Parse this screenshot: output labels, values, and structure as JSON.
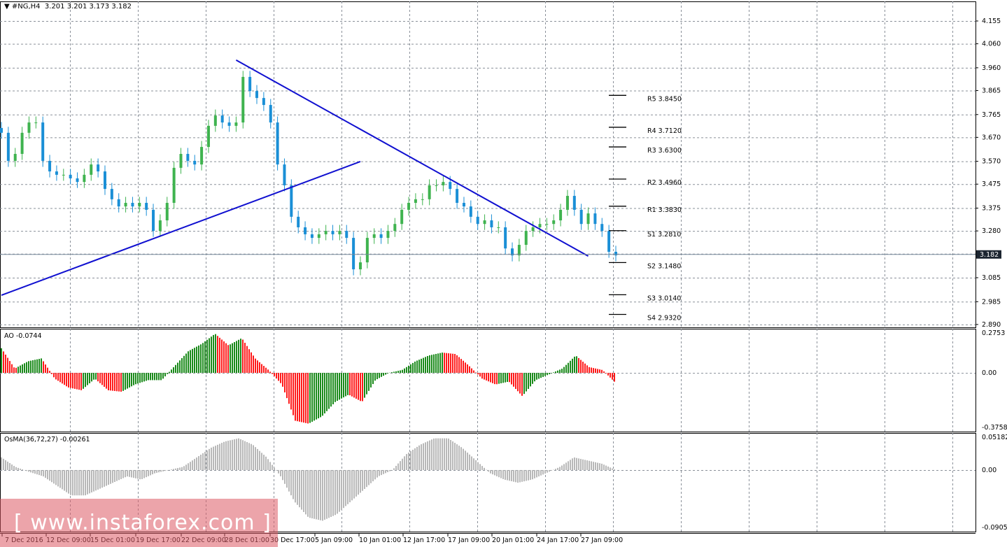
{
  "header": {
    "symbol": "#NG,H4",
    "ohlc": "3.201 3.201 3.173 3.182"
  },
  "colors": {
    "up": "#3fb34f",
    "down": "#1a8fd6",
    "trend": "#1010d0",
    "ao_up": "#1a8a1a",
    "ao_down": "#ff1a1a",
    "osma": "#b8b8b8",
    "grid": "#8a9099"
  },
  "chart_data": [
    {
      "type": "candlestick",
      "name": "price",
      "ylim": [
        2.86,
        4.2
      ],
      "y_ticks": [
        "4.155",
        "4.060",
        "3.960",
        "3.865",
        "3.765",
        "3.670",
        "3.570",
        "3.475",
        "3.375",
        "3.280",
        "3.185",
        "3.085",
        "2.985",
        "2.890"
      ],
      "closes": [
        3.689,
        3.572,
        3.601,
        3.689,
        3.732,
        3.732,
        3.572,
        3.528,
        3.514,
        3.514,
        3.499,
        3.484,
        3.514,
        3.557,
        3.528,
        3.455,
        3.412,
        3.382,
        3.397,
        3.382,
        3.397,
        3.368,
        3.28,
        3.324,
        3.397,
        3.543,
        3.601,
        3.572,
        3.557,
        3.63,
        3.718,
        3.761,
        3.732,
        3.718,
        3.732,
        3.922,
        3.863,
        3.834,
        3.805,
        3.732,
        3.557,
        3.47,
        3.339,
        3.295,
        3.266,
        3.251,
        3.266,
        3.28,
        3.266,
        3.28,
        3.251,
        3.12,
        3.149,
        3.251,
        3.266,
        3.251,
        3.28,
        3.309,
        3.368,
        3.397,
        3.412,
        3.412,
        3.47,
        3.47,
        3.484,
        3.455,
        3.397,
        3.382,
        3.339,
        3.309,
        3.324,
        3.295,
        3.295,
        3.207,
        3.178,
        3.222,
        3.28,
        3.295,
        3.309,
        3.309,
        3.324,
        3.368,
        3.426,
        3.368,
        3.309,
        3.353,
        3.309,
        3.28,
        3.193,
        3.178
      ],
      "current_price": "3.182",
      "trendlines": [
        {
          "from": [
            0,
            3.012
          ],
          "to": [
            52,
            3.569
          ]
        },
        {
          "from": [
            34,
            3.992
          ],
          "to": [
            85,
            3.175
          ]
        }
      ],
      "pivots": [
        {
          "label": "R5 3.8450",
          "value": 3.845
        },
        {
          "label": "R4 3.7120",
          "value": 3.712
        },
        {
          "label": "R3 3.6300",
          "value": 3.63
        },
        {
          "label": "R2 3.4960",
          "value": 3.496
        },
        {
          "label": "R1 3.3830",
          "value": 3.383
        },
        {
          "label": "S1 3.2810",
          "value": 3.281
        },
        {
          "label": "S2 3.1480",
          "value": 3.148
        },
        {
          "label": "S3 3.0140",
          "value": 3.014
        },
        {
          "label": "S4 2.9320",
          "value": 2.932
        }
      ]
    },
    {
      "type": "bar",
      "name": "AO",
      "title": "AO -0.0744",
      "ylim": [
        -0.3758,
        0.2753
      ],
      "y_ticks": [
        "0.2753",
        "0.00",
        "-0.3758"
      ],
      "values": [
        0.17,
        0.03,
        0.08,
        0.1,
        -0.04,
        -0.1,
        -0.12,
        -0.04,
        -0.12,
        -0.13,
        -0.08,
        -0.05,
        -0.05,
        0.05,
        0.15,
        0.2,
        0.27,
        0.19,
        0.24,
        0.1,
        0.02,
        -0.08,
        -0.33,
        -0.35,
        -0.3,
        -0.2,
        -0.15,
        -0.2,
        -0.05,
        0.0,
        0.02,
        0.08,
        0.12,
        0.14,
        0.13,
        0.05,
        -0.04,
        -0.08,
        -0.06,
        -0.16,
        -0.05,
        -0.01,
        0.03,
        0.12,
        0.04,
        0.02,
        -0.07
      ]
    },
    {
      "type": "bar",
      "name": "OsMA",
      "title": "OsMA(36,72,27) -0.00261",
      "ylim": [
        -0.09052,
        0.05182
      ],
      "y_ticks": [
        "0.05182",
        "0.00",
        "-0.09052"
      ],
      "values": [
        0.02,
        0.005,
        -0.003,
        -0.01,
        -0.025,
        -0.04,
        -0.04,
        -0.03,
        -0.02,
        -0.01,
        -0.015,
        -0.005,
        0,
        0.005,
        0.02,
        0.035,
        0.045,
        0.05,
        0.04,
        0.02,
        -0.01,
        -0.05,
        -0.075,
        -0.08,
        -0.07,
        -0.05,
        -0.03,
        -0.01,
        0,
        0.025,
        0.04,
        0.05,
        0.05,
        0.035,
        0.015,
        -0.005,
        -0.015,
        -0.02,
        -0.015,
        -0.005,
        0.005,
        0.02,
        0.015,
        0.01,
        0
      ]
    }
  ],
  "x_labels": [
    "7 Dec 2016",
    "12 Dec 09:00",
    "15 Dec 01:00",
    "19 Dec 17:00",
    "22 Dec 09:00",
    "28 Dec 01:00",
    "30 Dec 17:00",
    "5 Jan 09:00",
    "10 Jan 01:00",
    "12 Jan 17:00",
    "17 Jan 09:00",
    "20 Jan 01:00",
    "24 Jan 17:00",
    "27 Jan 09:00"
  ],
  "watermark": "[ www.instaforex.com ]"
}
